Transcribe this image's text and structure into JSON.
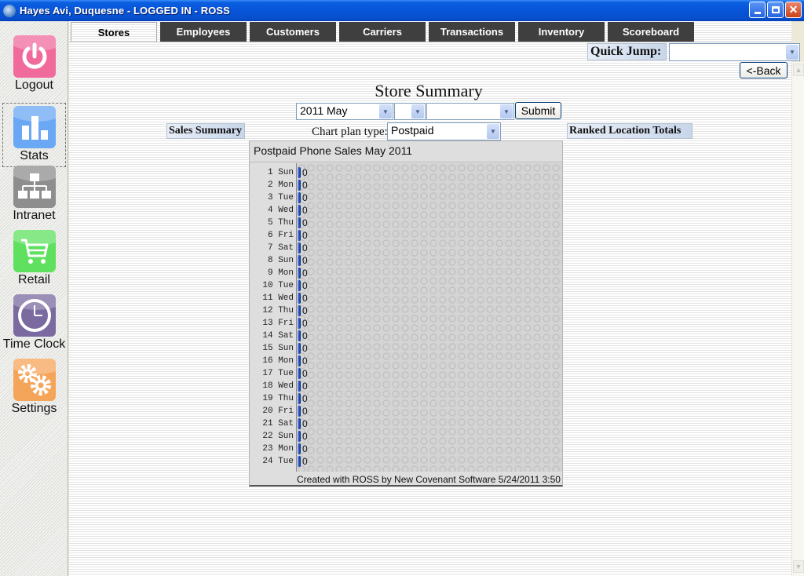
{
  "window": {
    "title": "Hayes Avi, Duquesne - LOGGED IN - ROSS",
    "controls": [
      "minimize",
      "restore",
      "close"
    ]
  },
  "sidebar": {
    "items": [
      {
        "label": "Logout",
        "icon": "power-icon",
        "color": "#f06a9c",
        "selected": false
      },
      {
        "label": "Stats",
        "icon": "bar-chart-icon",
        "color": "#6aa8f5",
        "selected": true
      },
      {
        "label": "Intranet",
        "icon": "network-icon",
        "color": "#8e8e8e",
        "selected": false
      },
      {
        "label": "Retail",
        "icon": "shopping-cart-icon",
        "color": "#5fe05f",
        "selected": false
      },
      {
        "label": "Time Clock",
        "icon": "clock-icon",
        "color": "#7a6aa0",
        "selected": false
      },
      {
        "label": "Settings",
        "icon": "gears-icon",
        "color": "#f5a55a",
        "selected": false
      }
    ]
  },
  "tabs": [
    {
      "label": "Stores",
      "active": true
    },
    {
      "label": "Employees",
      "active": false
    },
    {
      "label": "Customers",
      "active": false
    },
    {
      "label": "Carriers",
      "active": false
    },
    {
      "label": "Transactions",
      "active": false
    },
    {
      "label": "Inventory",
      "active": false
    },
    {
      "label": "Scoreboard",
      "active": false
    }
  ],
  "quick_jump": {
    "label": "Quick Jump:",
    "value": ""
  },
  "back_button": "<-Back",
  "page_title": "Store Summary",
  "filters": {
    "month": "2011 May",
    "second": "",
    "third": "",
    "submit": "Submit"
  },
  "sales_summary_label": "Sales Summary",
  "ranked_totals_label": "Ranked Location Totals",
  "chart_plan": {
    "label": "Chart plan type:",
    "value": "Postpaid"
  },
  "chart_data": {
    "type": "bar",
    "orientation": "horizontal",
    "title": "Postpaid Phone Sales May 2011",
    "categories": [
      "1 Sun",
      "2 Mon",
      "3 Tue",
      "4 Wed",
      "5 Thu",
      "6 Fri",
      "7 Sat",
      "8 Sun",
      "9 Mon",
      "10 Tue",
      "11 Wed",
      "12 Thu",
      "13 Fri",
      "14 Sat",
      "15 Sun",
      "16 Mon",
      "17 Tue",
      "18 Wed",
      "19 Thu",
      "20 Fri",
      "21 Sat",
      "22 Sun",
      "23 Mon",
      "24 Tue"
    ],
    "values": [
      0,
      0,
      0,
      0,
      0,
      0,
      0,
      0,
      0,
      0,
      0,
      0,
      0,
      0,
      0,
      0,
      0,
      0,
      0,
      0,
      0,
      0,
      0,
      0
    ],
    "xlabel": "",
    "ylabel": "",
    "footer": "Created with ROSS by New Covenant Software 5/24/2011 3:50",
    "bar_color": "#1f48b8"
  }
}
